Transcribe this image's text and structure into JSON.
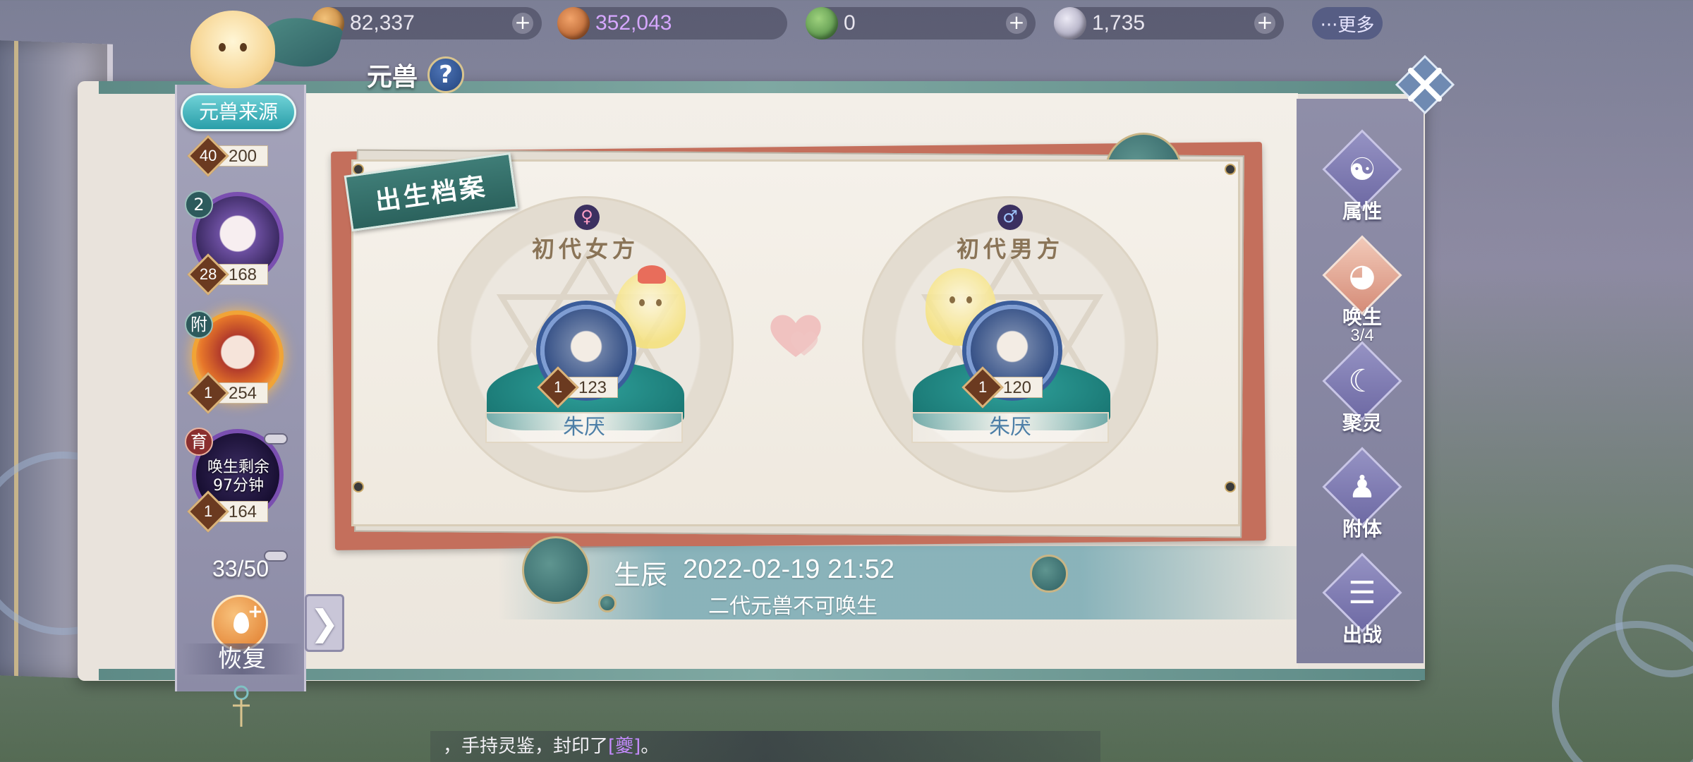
{
  "currencies": [
    {
      "icon": "shell-coin-icon",
      "value": "82,337",
      "color": "#c9893a"
    },
    {
      "icon": "gold-pouch-icon",
      "value": "352,043",
      "color": "#c36a2b",
      "value_color": "#d6a7ff"
    },
    {
      "icon": "green-leaf-coin-icon",
      "value": "0",
      "color": "#5c9b4a"
    },
    {
      "icon": "crystal-icon",
      "value": "1,735",
      "color": "#b9b6c8"
    }
  ],
  "more_label": "···更多",
  "title": "元兽",
  "help_label": "?",
  "source_button": "元兽来源",
  "pet_list": [
    {
      "tag": "",
      "level": "40",
      "value": "200"
    },
    {
      "tag": "2",
      "level": "28",
      "value": "168"
    },
    {
      "tag": "附",
      "level": "1",
      "value": "254"
    },
    {
      "tag": "育",
      "level": "1",
      "value": "164",
      "timer": "唤生剩余\n97分钟"
    }
  ],
  "pet_count": "33/50",
  "restore_label": "恢复",
  "collapse_label": "❯",
  "card": {
    "ribbon": "出生档案",
    "female": {
      "sex_symbol": "♀",
      "label": "初代女方",
      "level": "1",
      "value": "123",
      "name": "朱厌"
    },
    "male": {
      "sex_symbol": "♂",
      "label": "初代男方",
      "level": "1",
      "value": "120",
      "name": "朱厌"
    }
  },
  "birth": {
    "label": "生辰",
    "time": "2022-02-19 21:52",
    "note": "二代元兽不可唤生"
  },
  "tabs": [
    {
      "id": "attributes",
      "icon": "yin-yang-icon",
      "glyph": "☯",
      "label": "属性"
    },
    {
      "id": "summon",
      "icon": "spirit-icon",
      "glyph": "◕",
      "label": "唤生",
      "sub": "3/4",
      "active": true
    },
    {
      "id": "gather",
      "icon": "moon-spirit-icon",
      "glyph": "☾",
      "label": "聚灵"
    },
    {
      "id": "attach",
      "icon": "figure-icon",
      "glyph": "♟",
      "label": "附体"
    },
    {
      "id": "battle",
      "icon": "banner-icon",
      "glyph": "☰",
      "label": "出战"
    }
  ],
  "system_message": {
    "prefix": "，手持灵鉴，封印了",
    "highlight": "[夔]",
    "suffix": "。"
  }
}
